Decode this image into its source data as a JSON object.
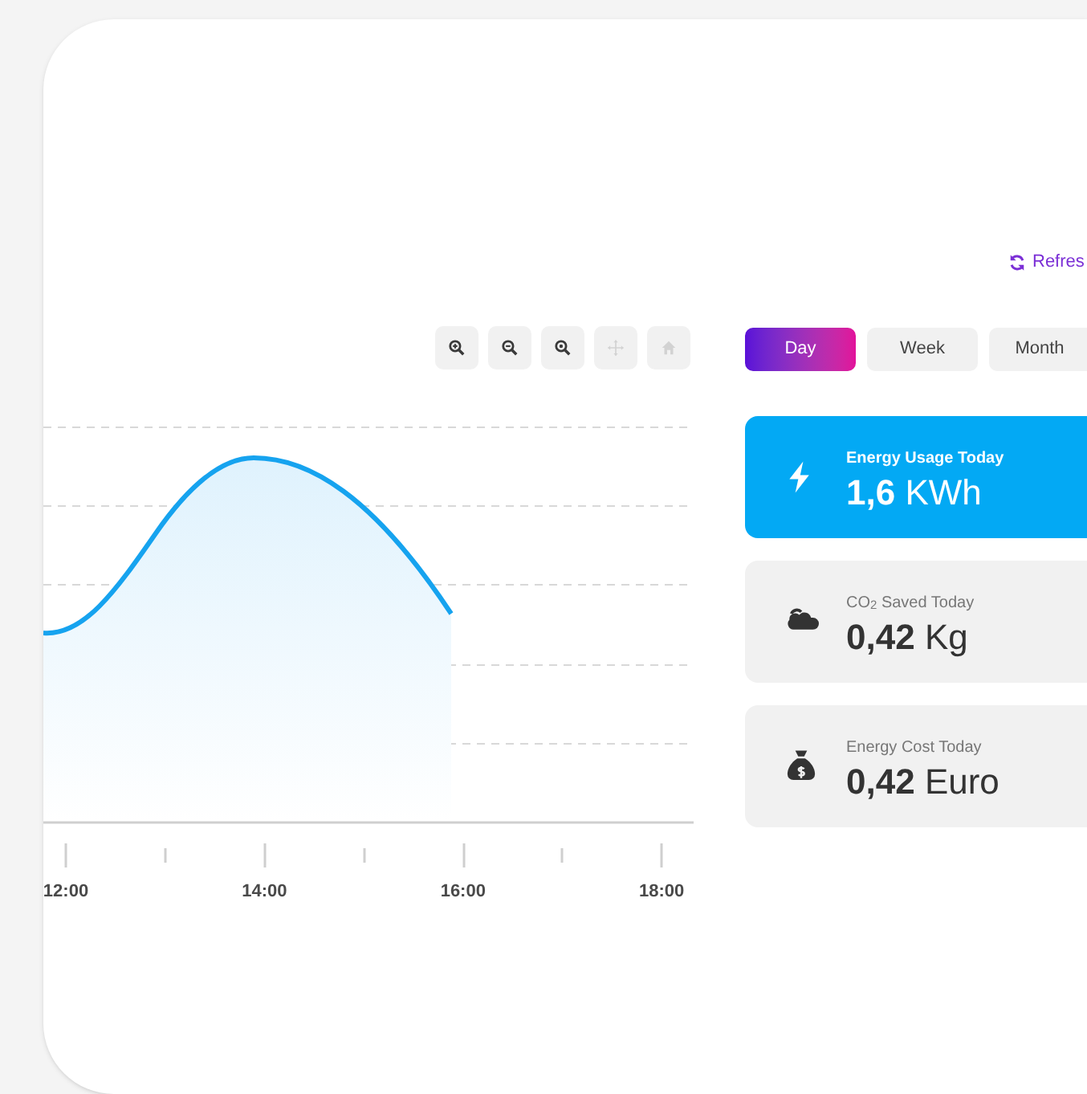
{
  "refresh": {
    "label": "Refres"
  },
  "tools": [
    {
      "kind": "zoom-in",
      "disabled": false
    },
    {
      "kind": "zoom-out",
      "disabled": false
    },
    {
      "kind": "zoom-reset",
      "disabled": false
    },
    {
      "kind": "pan",
      "disabled": true
    },
    {
      "kind": "home",
      "disabled": true
    }
  ],
  "chart": {
    "x_labels": [
      "12:00",
      "14:00",
      "16:00",
      "18:00"
    ]
  },
  "tabs": [
    {
      "label": "Day",
      "selected": true
    },
    {
      "label": "Week",
      "selected": false
    },
    {
      "label": "Month",
      "selected": false
    }
  ],
  "cards": [
    {
      "kind": "energy",
      "title": "Energy Usage Today",
      "value": "**1,6** KWh",
      "selected": true
    },
    {
      "kind": "co2",
      "title": "CO$_{2}$ Saved Today",
      "value": "**0,42** Kg",
      "selected": false
    },
    {
      "kind": "cost",
      "title": "Energy Cost Today",
      "value": "**0,42** Euro",
      "selected": false
    }
  ]
}
